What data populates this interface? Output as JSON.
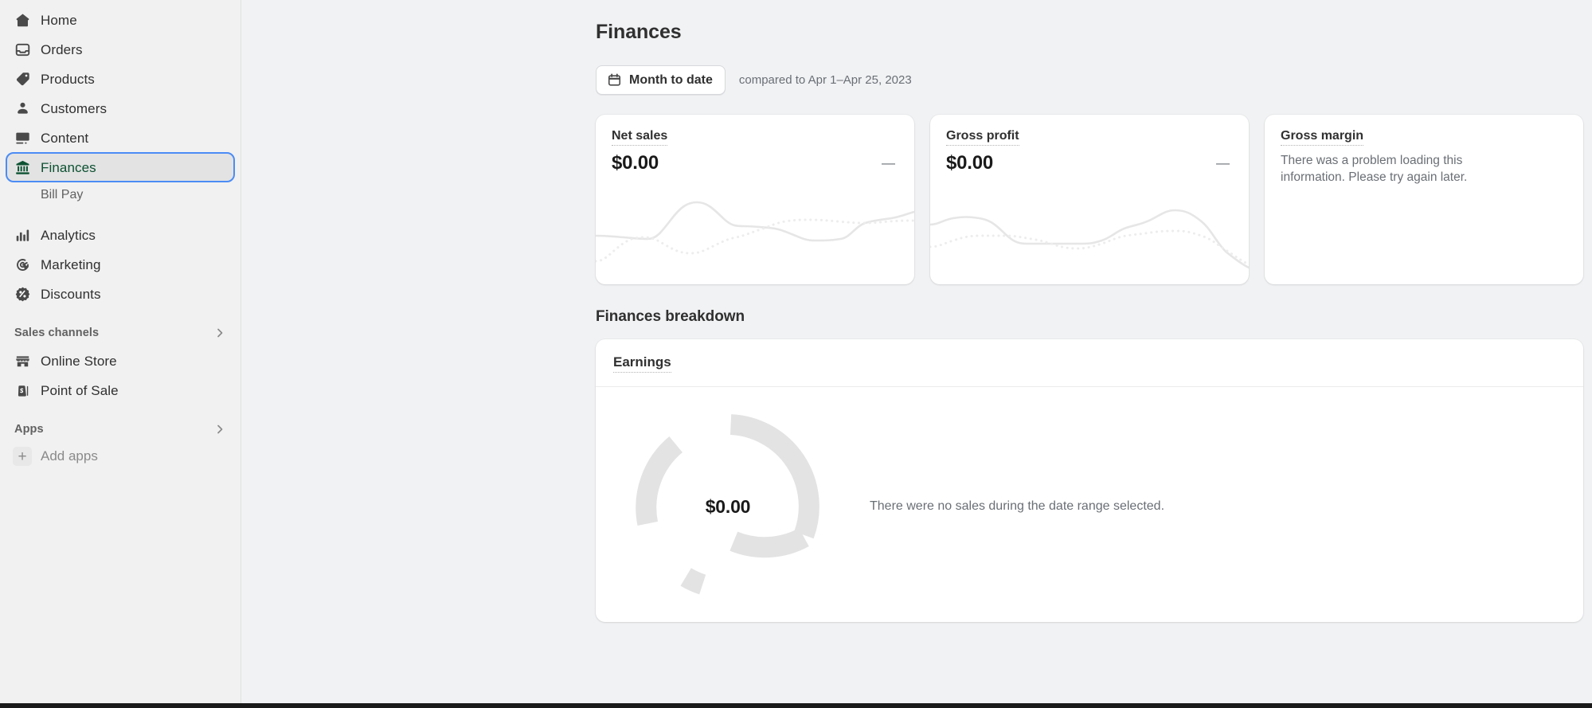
{
  "sidebar": {
    "items": [
      {
        "label": "Home",
        "icon": "home-icon"
      },
      {
        "label": "Orders",
        "icon": "orders-icon"
      },
      {
        "label": "Products",
        "icon": "products-tag-icon"
      },
      {
        "label": "Customers",
        "icon": "customers-person-icon"
      },
      {
        "label": "Content",
        "icon": "content-image-icon"
      },
      {
        "label": "Finances",
        "icon": "finances-bank-icon",
        "selected": true
      }
    ],
    "sub_item": {
      "label": "Bill Pay"
    },
    "items2": [
      {
        "label": "Analytics",
        "icon": "analytics-bars-icon"
      },
      {
        "label": "Marketing",
        "icon": "marketing-target-icon"
      },
      {
        "label": "Discounts",
        "icon": "discounts-percent-icon"
      }
    ],
    "sales_channels": {
      "title": "Sales channels",
      "chevron": "chevron-right-icon"
    },
    "channels": [
      {
        "label": "Online Store",
        "icon": "online-store-icon"
      },
      {
        "label": "Point of Sale",
        "icon": "point-of-sale-icon"
      }
    ],
    "apps": {
      "title": "Apps",
      "chevron": "chevron-right-icon"
    },
    "add_apps": {
      "label": "Add apps",
      "icon": "plus-icon"
    }
  },
  "page": {
    "title": "Finances",
    "date_button": "Month to date",
    "date_icon": "calendar-icon",
    "compare_text": "compared to Apr 1–Apr 25, 2023",
    "breakdown_heading": "Finances breakdown"
  },
  "cards": [
    {
      "label": "Net sales",
      "value": "$0.00",
      "delta": "—",
      "has_chart": true
    },
    {
      "label": "Gross profit",
      "value": "$0.00",
      "delta": "—",
      "has_chart": true
    },
    {
      "label": "Gross margin",
      "error": "There was a problem loading this information. Please try again later.",
      "has_chart": false
    }
  ],
  "earnings": {
    "title": "Earnings",
    "center_value": "$0.00",
    "empty_note": "There were no sales during the date range selected."
  },
  "colors": {
    "background": "#f1f2f4",
    "sidebar_bg": "#f1f1f1",
    "card_bg": "#ffffff",
    "selected_text": "#0c5132",
    "focus_ring": "#4b8cf5",
    "muted_text": "#6a6f75",
    "donut_segment": "#e3e3e3",
    "sparkline": "#e9e9e9"
  },
  "chart_data": [
    {
      "type": "line",
      "name": "Net sales sparkline",
      "title": "Net sales",
      "xlabel": "",
      "ylabel": "",
      "grid": false,
      "legend": "none",
      "series": [
        {
          "name": "current",
          "style": "solid",
          "values": [
            30,
            30,
            29,
            28,
            31,
            56,
            62,
            55,
            44,
            43,
            42,
            40,
            33,
            28,
            27,
            28,
            36,
            43,
            44,
            46,
            47,
            50,
            51
          ]
        },
        {
          "name": "previous",
          "style": "dotted",
          "values": [
            8,
            14,
            25,
            33,
            33,
            29,
            22,
            18,
            18,
            22,
            30,
            36,
            42,
            46,
            47,
            46,
            45,
            45,
            45,
            46,
            46,
            45,
            45
          ]
        }
      ]
    },
    {
      "type": "line",
      "name": "Gross profit sparkline",
      "title": "Gross profit",
      "xlabel": "",
      "ylabel": "",
      "grid": false,
      "legend": "none",
      "series": [
        {
          "name": "current",
          "style": "solid",
          "values": [
            48,
            52,
            56,
            56,
            52,
            35,
            27,
            27,
            27,
            27,
            28,
            30,
            38,
            45,
            45,
            45,
            52,
            60,
            60,
            55,
            40,
            20,
            12
          ]
        },
        {
          "name": "previous",
          "style": "dotted",
          "values": [
            26,
            30,
            35,
            38,
            38,
            38,
            36,
            28,
            24,
            24,
            28,
            34,
            40,
            42,
            43,
            44,
            44,
            44,
            42,
            35,
            24,
            16,
            14
          ]
        }
      ]
    },
    {
      "type": "pie",
      "name": "Earnings donut",
      "title": "Earnings",
      "center_label": "$0.00",
      "total": 0,
      "legend": "none",
      "slices": [
        {
          "label": "segment-1",
          "value": 0,
          "arc_degrees": 108,
          "color": "#e3e3e3"
        },
        {
          "label": "segment-2",
          "value": 0,
          "arc_degrees": 86,
          "color": "#e3e3e3"
        },
        {
          "label": "segment-3",
          "value": 0,
          "arc_degrees": 60,
          "color": "#e3e3e3"
        },
        {
          "label": "segment-4",
          "value": 0,
          "arc_degrees": 106,
          "color": "#e3e3e3"
        }
      ]
    }
  ]
}
